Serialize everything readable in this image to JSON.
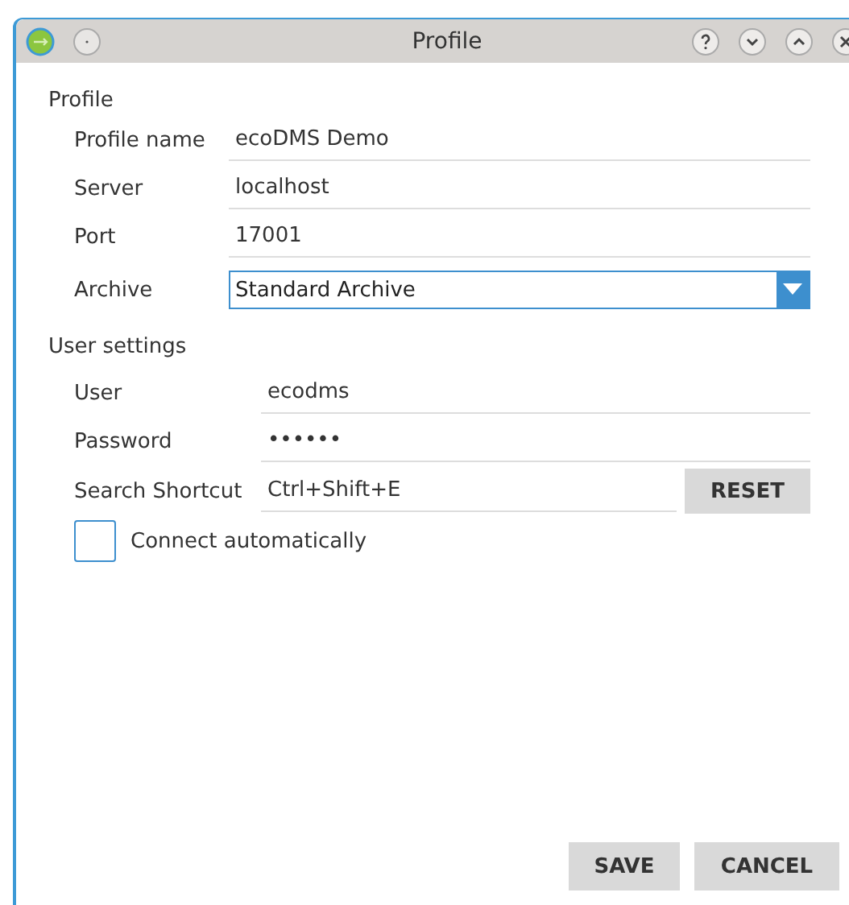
{
  "window": {
    "title": "Profile"
  },
  "profile": {
    "heading": "Profile",
    "fields": [
      {
        "label": "Profile name",
        "value": "ecoDMS Demo",
        "kind": "text"
      },
      {
        "label": "Server",
        "value": "localhost",
        "kind": "text"
      },
      {
        "label": "Port",
        "value": "17001",
        "kind": "text"
      },
      {
        "label": "Archive",
        "value": "Standard Archive",
        "kind": "dropdown"
      }
    ]
  },
  "user_settings": {
    "heading": "User settings",
    "fields": [
      {
        "label": "User",
        "value": "ecodms",
        "kind": "text"
      },
      {
        "label": "Password",
        "value": "••••••",
        "kind": "text"
      },
      {
        "label": "Search Shortcut",
        "value": "Ctrl+Shift+E",
        "kind": "shortcut",
        "button": "RESET"
      }
    ]
  },
  "connect_automatically": {
    "label": "Connect automatically",
    "checked": false
  },
  "buttons": [
    "SAVE",
    "CANCEL"
  ]
}
